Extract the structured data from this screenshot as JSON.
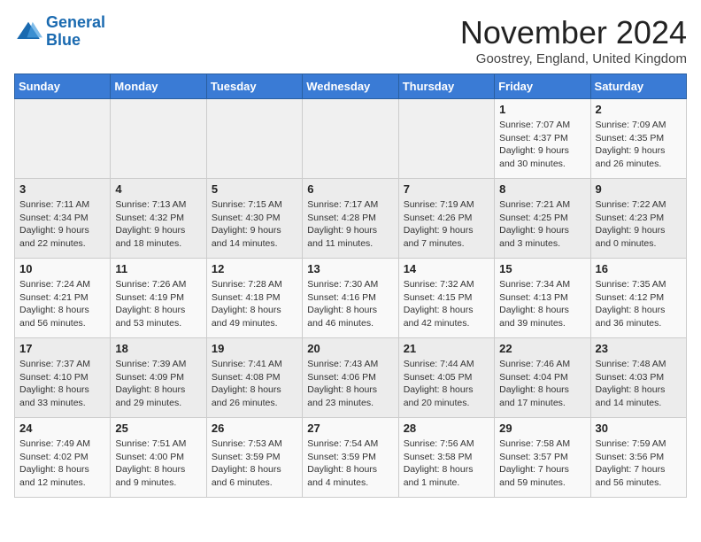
{
  "logo": {
    "line1": "General",
    "line2": "Blue"
  },
  "title": "November 2024",
  "location": "Goostrey, England, United Kingdom",
  "days_header": [
    "Sunday",
    "Monday",
    "Tuesday",
    "Wednesday",
    "Thursday",
    "Friday",
    "Saturday"
  ],
  "weeks": [
    [
      {
        "day": "",
        "info": ""
      },
      {
        "day": "",
        "info": ""
      },
      {
        "day": "",
        "info": ""
      },
      {
        "day": "",
        "info": ""
      },
      {
        "day": "",
        "info": ""
      },
      {
        "day": "1",
        "info": "Sunrise: 7:07 AM\nSunset: 4:37 PM\nDaylight: 9 hours and 30 minutes."
      },
      {
        "day": "2",
        "info": "Sunrise: 7:09 AM\nSunset: 4:35 PM\nDaylight: 9 hours and 26 minutes."
      }
    ],
    [
      {
        "day": "3",
        "info": "Sunrise: 7:11 AM\nSunset: 4:34 PM\nDaylight: 9 hours and 22 minutes."
      },
      {
        "day": "4",
        "info": "Sunrise: 7:13 AM\nSunset: 4:32 PM\nDaylight: 9 hours and 18 minutes."
      },
      {
        "day": "5",
        "info": "Sunrise: 7:15 AM\nSunset: 4:30 PM\nDaylight: 9 hours and 14 minutes."
      },
      {
        "day": "6",
        "info": "Sunrise: 7:17 AM\nSunset: 4:28 PM\nDaylight: 9 hours and 11 minutes."
      },
      {
        "day": "7",
        "info": "Sunrise: 7:19 AM\nSunset: 4:26 PM\nDaylight: 9 hours and 7 minutes."
      },
      {
        "day": "8",
        "info": "Sunrise: 7:21 AM\nSunset: 4:25 PM\nDaylight: 9 hours and 3 minutes."
      },
      {
        "day": "9",
        "info": "Sunrise: 7:22 AM\nSunset: 4:23 PM\nDaylight: 9 hours and 0 minutes."
      }
    ],
    [
      {
        "day": "10",
        "info": "Sunrise: 7:24 AM\nSunset: 4:21 PM\nDaylight: 8 hours and 56 minutes."
      },
      {
        "day": "11",
        "info": "Sunrise: 7:26 AM\nSunset: 4:19 PM\nDaylight: 8 hours and 53 minutes."
      },
      {
        "day": "12",
        "info": "Sunrise: 7:28 AM\nSunset: 4:18 PM\nDaylight: 8 hours and 49 minutes."
      },
      {
        "day": "13",
        "info": "Sunrise: 7:30 AM\nSunset: 4:16 PM\nDaylight: 8 hours and 46 minutes."
      },
      {
        "day": "14",
        "info": "Sunrise: 7:32 AM\nSunset: 4:15 PM\nDaylight: 8 hours and 42 minutes."
      },
      {
        "day": "15",
        "info": "Sunrise: 7:34 AM\nSunset: 4:13 PM\nDaylight: 8 hours and 39 minutes."
      },
      {
        "day": "16",
        "info": "Sunrise: 7:35 AM\nSunset: 4:12 PM\nDaylight: 8 hours and 36 minutes."
      }
    ],
    [
      {
        "day": "17",
        "info": "Sunrise: 7:37 AM\nSunset: 4:10 PM\nDaylight: 8 hours and 33 minutes."
      },
      {
        "day": "18",
        "info": "Sunrise: 7:39 AM\nSunset: 4:09 PM\nDaylight: 8 hours and 29 minutes."
      },
      {
        "day": "19",
        "info": "Sunrise: 7:41 AM\nSunset: 4:08 PM\nDaylight: 8 hours and 26 minutes."
      },
      {
        "day": "20",
        "info": "Sunrise: 7:43 AM\nSunset: 4:06 PM\nDaylight: 8 hours and 23 minutes."
      },
      {
        "day": "21",
        "info": "Sunrise: 7:44 AM\nSunset: 4:05 PM\nDaylight: 8 hours and 20 minutes."
      },
      {
        "day": "22",
        "info": "Sunrise: 7:46 AM\nSunset: 4:04 PM\nDaylight: 8 hours and 17 minutes."
      },
      {
        "day": "23",
        "info": "Sunrise: 7:48 AM\nSunset: 4:03 PM\nDaylight: 8 hours and 14 minutes."
      }
    ],
    [
      {
        "day": "24",
        "info": "Sunrise: 7:49 AM\nSunset: 4:02 PM\nDaylight: 8 hours and 12 minutes."
      },
      {
        "day": "25",
        "info": "Sunrise: 7:51 AM\nSunset: 4:00 PM\nDaylight: 8 hours and 9 minutes."
      },
      {
        "day": "26",
        "info": "Sunrise: 7:53 AM\nSunset: 3:59 PM\nDaylight: 8 hours and 6 minutes."
      },
      {
        "day": "27",
        "info": "Sunrise: 7:54 AM\nSunset: 3:59 PM\nDaylight: 8 hours and 4 minutes."
      },
      {
        "day": "28",
        "info": "Sunrise: 7:56 AM\nSunset: 3:58 PM\nDaylight: 8 hours and 1 minute."
      },
      {
        "day": "29",
        "info": "Sunrise: 7:58 AM\nSunset: 3:57 PM\nDaylight: 7 hours and 59 minutes."
      },
      {
        "day": "30",
        "info": "Sunrise: 7:59 AM\nSunset: 3:56 PM\nDaylight: 7 hours and 56 minutes."
      }
    ]
  ]
}
